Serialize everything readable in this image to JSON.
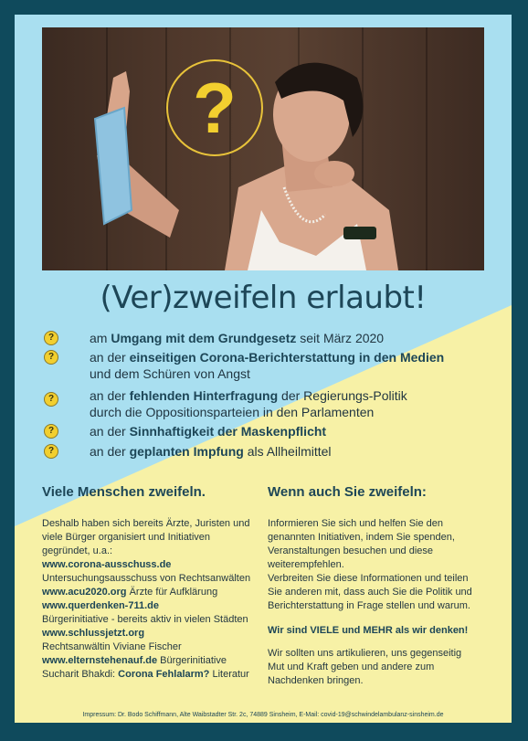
{
  "headline": "(Ver)zweifeln erlaubt!",
  "photo": {
    "question_mark": "?"
  },
  "bullets": [
    {
      "icon": "?",
      "pre": "am ",
      "bold": "Umgang mit dem Grundgesetz",
      "post": " seit März 2020",
      "line2": ""
    },
    {
      "icon": "?",
      "pre": "an der ",
      "bold": "einseitigen Corona-Berichterstattung in den Medien",
      "post": "",
      "line2": "und dem Schüren von Angst"
    },
    {
      "icon": "?",
      "pre": "an der ",
      "bold": "fehlenden Hinterfragung",
      "post": " der Regierungs-Politik",
      "line2": "durch die Oppositionsparteien in den Parlamenten"
    },
    {
      "icon": "?",
      "pre": "an der ",
      "bold": "Sinnhaftigkeit der Maskenpflicht",
      "post": "",
      "line2": ""
    },
    {
      "icon": "?",
      "pre": "an der ",
      "bold": "geplanten Impfung",
      "post": " als Allheilmittel",
      "line2": ""
    }
  ],
  "left": {
    "heading": "Viele Menschen zweifeln.",
    "intro1": "Deshalb haben sich bereits Ärzte, Juristen und",
    "intro2": "viele Bürger organisiert und Initiativen",
    "intro3": "gegründet, u.a.:",
    "link1": "www.corona-ausschuss.de",
    "desc1": "Untersuchungsausschuss von Rechtsanwälten",
    "link2": "www.acu2020.org",
    "desc2": " Ärzte für Aufklärung",
    "link3": "www.querdenken-711.de",
    "desc3": "Bürgerinitiative - bereits aktiv in vielen Städten",
    "link4": "www.schlussjetzt.org",
    "desc4": "Rechtsanwältin Viviane Fischer",
    "link5": "www.elternstehenauf.de",
    "desc5": " Bürgerinitiative",
    "desc6a": "Sucharit Bhakdi: ",
    "desc6b": "Corona Fehlalarm?",
    "desc6c": " Literatur"
  },
  "right": {
    "heading": "Wenn auch Sie zweifeln:",
    "p1": "Informieren Sie sich und helfen Sie den",
    "p2": "genannten Initiativen, indem Sie spenden,",
    "p3": "Veranstaltungen besuchen und diese",
    "p4": "weiterempfehlen.",
    "p5": "Verbreiten Sie diese Informationen und teilen",
    "p6": "Sie anderen mit, dass auch Sie die Politik und",
    "p7": "Berichterstattung in Frage stellen und warum.",
    "emphasis": "Wir sind VIELE und MEHR als wir denken!",
    "p8": "Wir sollten uns artikulieren, uns gegenseitig",
    "p9": "Mut und Kraft geben und andere zum",
    "p10": "Nachdenken bringen."
  },
  "imprint": "Impressum: Dr. Bodo Schiffmann, Alte Waibstadter Str. 2c, 74889 Sinsheim, E-Mail: covid-19@schwindelambulanz-sinsheim.de",
  "colors": {
    "frame": "#0f4a5c",
    "blue": "#a9dff0",
    "yellow": "#f7f1a6",
    "accent": "#f2cf2f",
    "heading": "#1d4657"
  }
}
